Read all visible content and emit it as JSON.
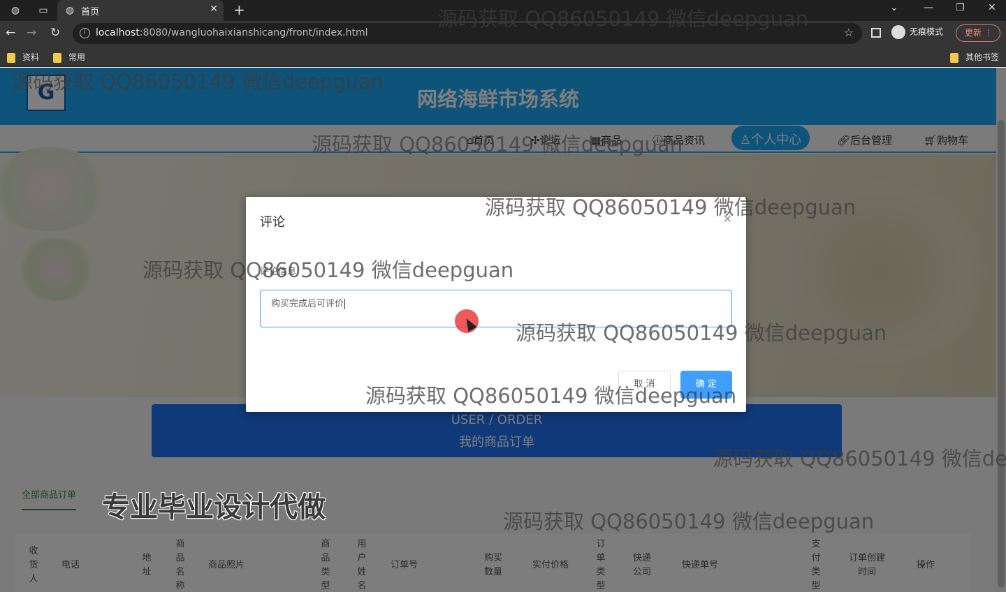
{
  "browser": {
    "tab_title": "首页",
    "url_host": "localhost",
    "url_rest": ":8080/wangluohaixianshicang/front/index.html",
    "incognito_label": "无痕模式",
    "update_label": "更新",
    "bookmarks": [
      "资料",
      "常用"
    ],
    "other_bookmarks": "其他书签"
  },
  "site": {
    "title": "网络海鲜市场系统",
    "nav": [
      "首页",
      "论坛",
      "商品",
      "商品资讯",
      "个人中心",
      "后台管理",
      "购物车"
    ]
  },
  "order_banner": {
    "en": "USER / ORDER",
    "cn": "我的商品订单"
  },
  "order_tabs": [
    "全部商品订单"
  ],
  "table_headers": {
    "receiver": "收货人",
    "phone": "电话",
    "address": "地址",
    "product_name": "商品名称",
    "product_photo": "商品照片",
    "product_type": "商品类型",
    "username": "用户姓名",
    "order_no": "订单号",
    "quantity": "购买数量",
    "paid_price": "实付价格",
    "order_type": "订单类型",
    "courier": "快递公司",
    "tracking_no": "快递单号",
    "pay_type": "支付类型",
    "created_at": "订单创建时间",
    "actions": "操作"
  },
  "dialog": {
    "title": "评论",
    "label": "评论信息",
    "textarea_value": "购买完成后可评价",
    "cancel": "取 消",
    "confirm": "确 定"
  },
  "overlay": {
    "watermark": "源码获取 QQ86050149 微信deepguan",
    "promo": "专业毕业设计代做"
  }
}
